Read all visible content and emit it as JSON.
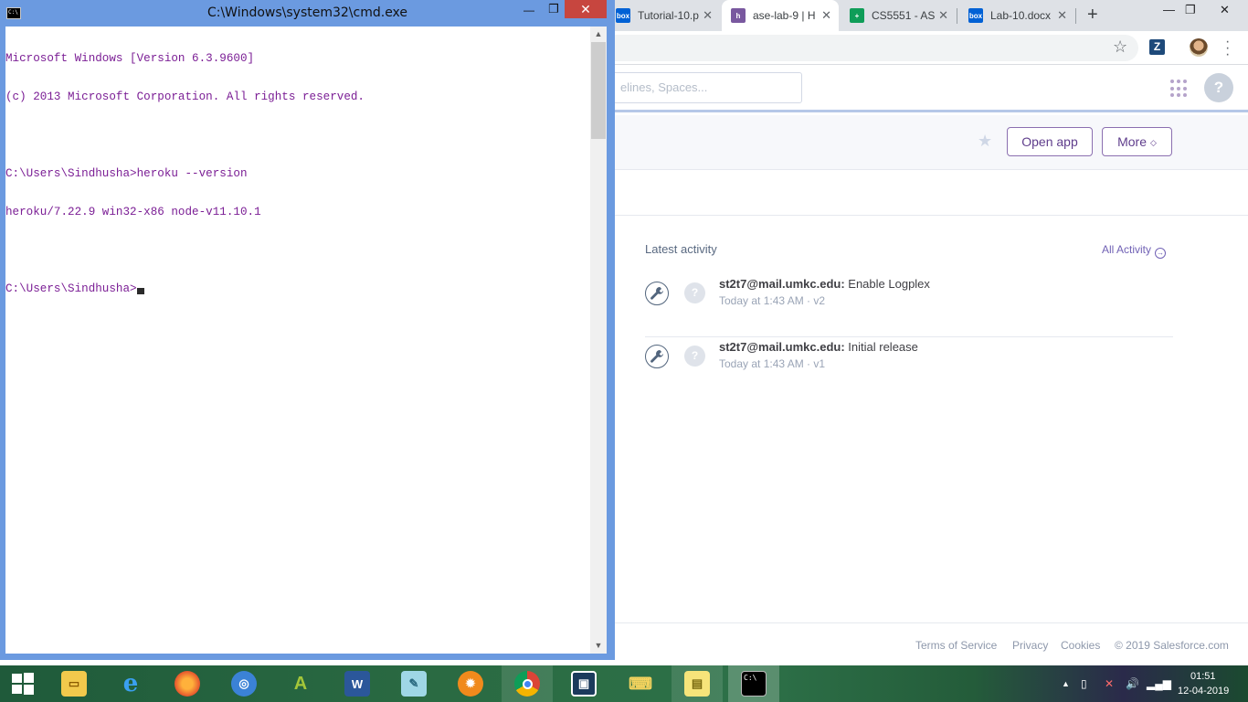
{
  "browser": {
    "tabs": [
      {
        "title": "Tutorial-10.p",
        "favicon": "box-icon",
        "color": "#0061d5"
      },
      {
        "title": "ase-lab-9 | H",
        "favicon": "heroku-icon",
        "color": "#79589f"
      },
      {
        "title": "CS5551 - AS",
        "favicon": "sheets-icon",
        "color": "#0f9d58"
      },
      {
        "title": "Lab-10.docx",
        "favicon": "box-icon",
        "color": "#0061d5"
      }
    ],
    "new_tab": "+",
    "window_controls": {
      "minimize": "—",
      "maximize": "❐",
      "close": "✕"
    }
  },
  "heroku": {
    "search_placeholder": "elines, Spaces...",
    "buttons": {
      "open_app": "Open app",
      "more": "More"
    },
    "activity": {
      "title": "Latest activity",
      "all_link": "All Activity",
      "items": [
        {
          "user": "st2t7@mail.umkc.edu:",
          "action": " Enable Logplex",
          "meta": "Today at 1:43 AM · v2"
        },
        {
          "user": "st2t7@mail.umkc.edu:",
          "action": " Initial release",
          "meta": "Today at 1:43 AM · v1"
        }
      ]
    },
    "footer": {
      "terms": "Terms of Service",
      "privacy": "Privacy",
      "cookies": "Cookies",
      "copyright": "© 2019 Salesforce.com"
    }
  },
  "cmd": {
    "title": "C:\\Windows\\system32\\cmd.exe",
    "icon_text": "C:\\",
    "lines": [
      "Microsoft Windows [Version 6.3.9600]",
      "(c) 2013 Microsoft Corporation. All rights reserved.",
      "",
      "C:\\Users\\Sindhusha>heroku --version",
      "heroku/7.22.9 win32-x86 node-v11.10.1",
      "",
      "C:\\Users\\Sindhusha>"
    ],
    "text_color": "#7b1e95",
    "close_glyph": "✕",
    "min_glyph": "—",
    "max_glyph": "❐"
  },
  "taskbar": {
    "apps": [
      {
        "name": "file-explorer-icon",
        "glyph": "📁"
      },
      {
        "name": "internet-explorer-icon",
        "glyph": "e"
      },
      {
        "name": "firefox-icon",
        "glyph": "🦊"
      },
      {
        "name": "app-blue-circle-icon",
        "glyph": "◎"
      },
      {
        "name": "android-studio-icon",
        "glyph": "A"
      },
      {
        "name": "word-icon",
        "glyph": "W"
      },
      {
        "name": "notepad-icon",
        "glyph": "✎"
      },
      {
        "name": "orange-app-icon",
        "glyph": "✹"
      },
      {
        "name": "chrome-icon",
        "glyph": "●"
      },
      {
        "name": "gitkraken-icon",
        "glyph": "▣"
      },
      {
        "name": "network-tool-icon",
        "glyph": "⌨"
      },
      {
        "name": "sticky-notes-icon",
        "glyph": "▤"
      },
      {
        "name": "cmd-icon",
        "glyph": "C:\\"
      }
    ],
    "time": "01:51",
    "date": "12-04-2019"
  }
}
